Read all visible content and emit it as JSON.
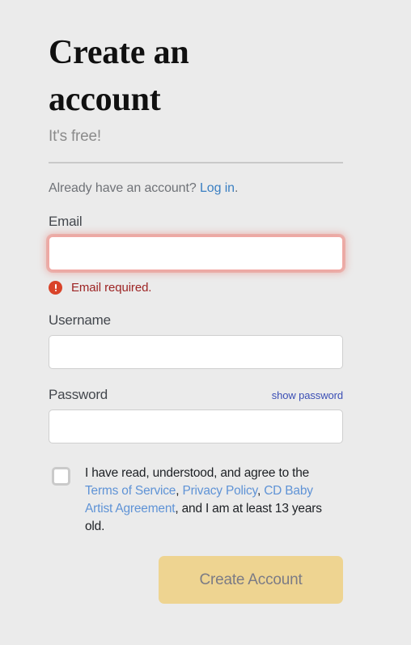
{
  "header": {
    "title": "Create an account",
    "subtitle": "It's free!"
  },
  "login_prompt": {
    "text": "Already have an account? ",
    "link_label": "Log in",
    "trailing": "."
  },
  "fields": {
    "email": {
      "label": "Email",
      "value": "",
      "placeholder": "",
      "error": "Email required.",
      "error_icon": "alert-circle-icon",
      "has_error": true
    },
    "username": {
      "label": "Username",
      "value": "",
      "placeholder": ""
    },
    "password": {
      "label": "Password",
      "value": "",
      "placeholder": "",
      "toggle_label": "show password"
    }
  },
  "terms": {
    "checked": false,
    "part1": "I have read, understood, and agree to the ",
    "link1": "Terms of Service",
    "sep1": ", ",
    "link2": "Privacy Policy",
    "sep2": ", ",
    "link3": "CD Baby Artist Agreement",
    "part2": ", and I am at least 13 years old."
  },
  "submit": {
    "label": "Create Account"
  },
  "colors": {
    "background": "#ebebeb",
    "link_blue": "#3a7fc2",
    "terms_link_blue": "#5f93d6",
    "show_password_blue": "#3b4fb5",
    "error_red": "#9d2424",
    "error_icon_red": "#d9442a",
    "button_tan": "#eed491",
    "button_text": "#7b7b85"
  }
}
